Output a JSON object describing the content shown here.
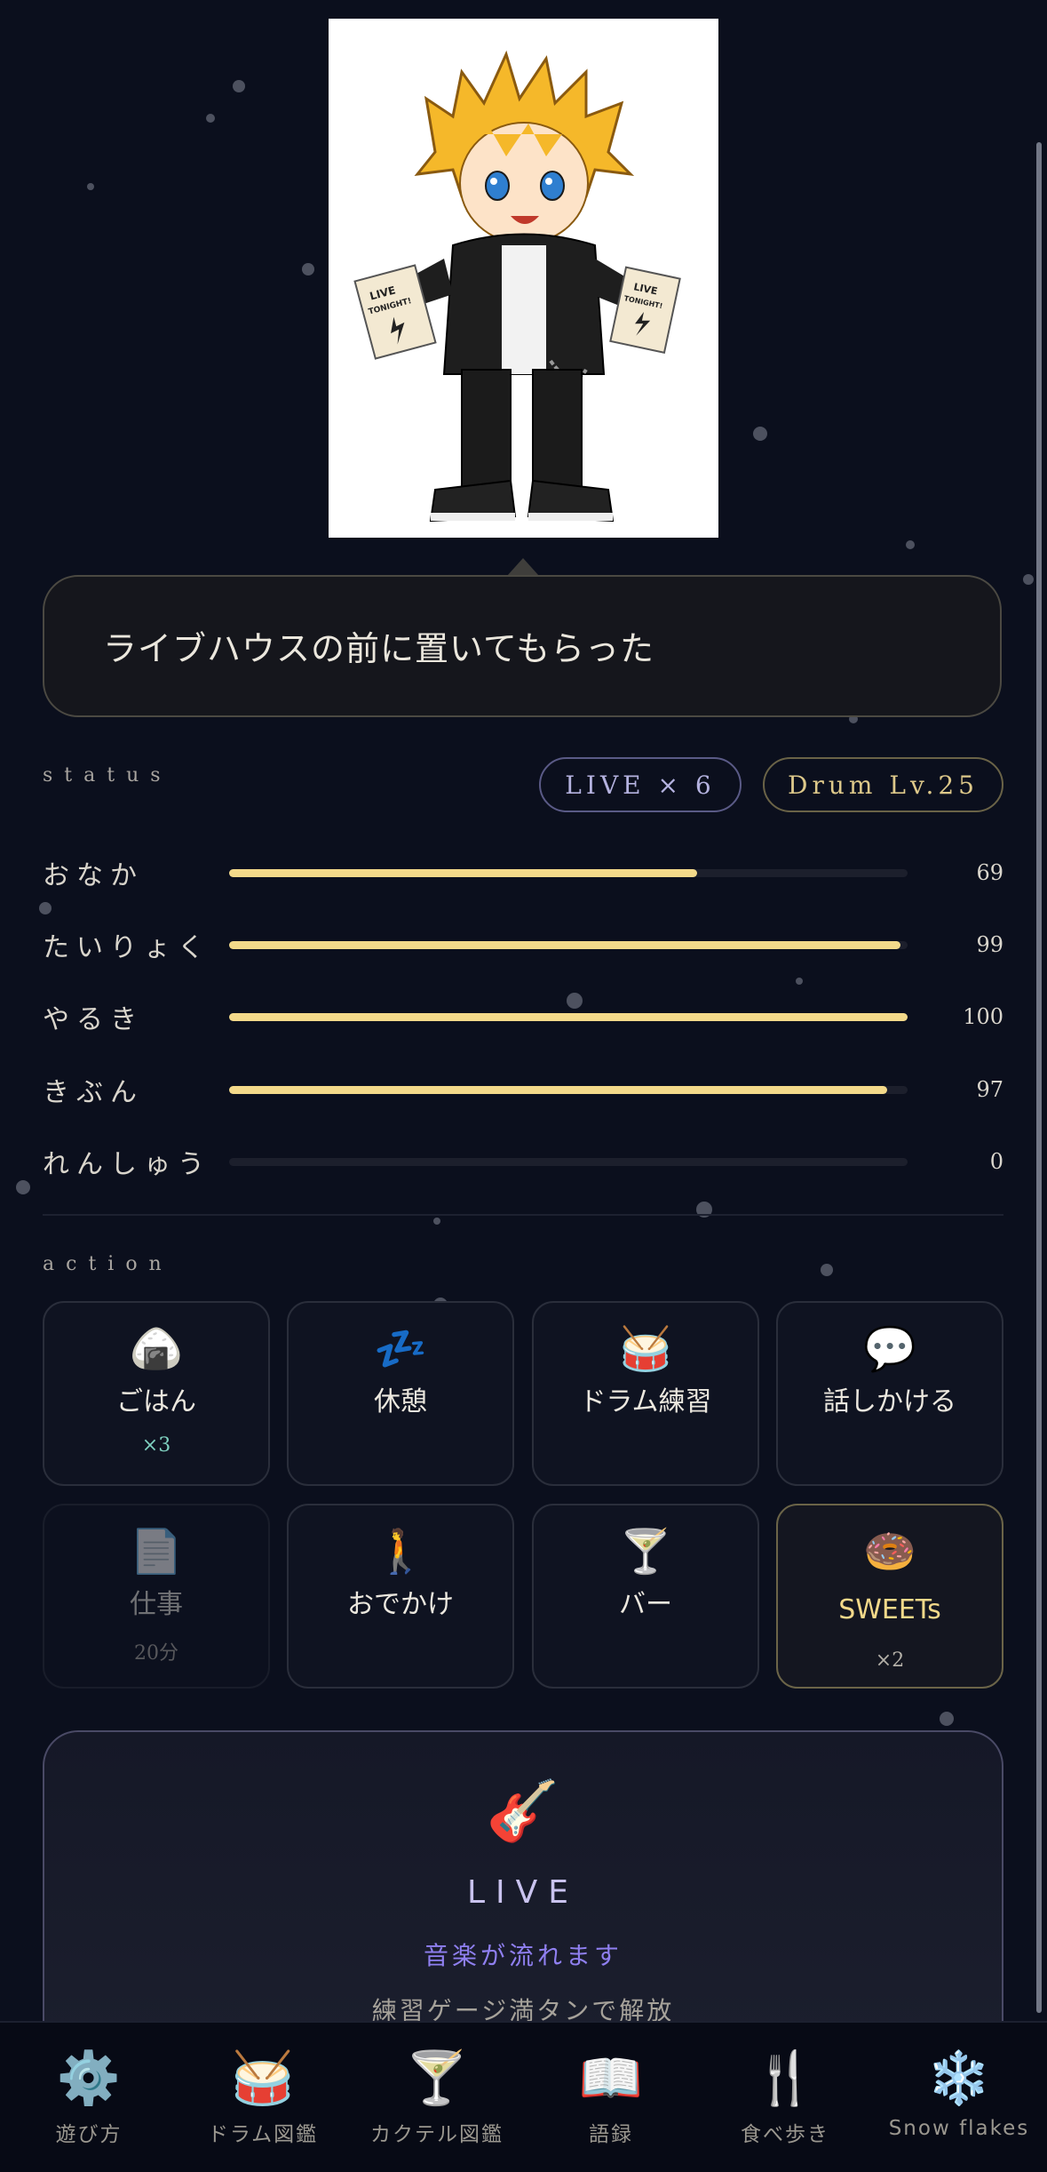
{
  "speech": {
    "text": "ライブハウスの前に置いてもらった"
  },
  "status": {
    "section_label": "status",
    "badges": {
      "live": "LIVE × 6",
      "drum": "Drum Lv.25"
    },
    "stats": [
      {
        "label": "おなか",
        "value": "69",
        "level": 0.69
      },
      {
        "label": "たいりょく",
        "value": "99",
        "level": 0.99
      },
      {
        "label": "やるき",
        "value": "100",
        "level": 1.0
      },
      {
        "label": "きぶん",
        "value": "97",
        "level": 0.97
      },
      {
        "label": "れんしゅう",
        "value": "0",
        "level": 0.0
      }
    ]
  },
  "action": {
    "section_label": "action",
    "items": [
      {
        "label": "ごはん",
        "sub": "×3",
        "icon": "rice-ball-icon",
        "glyph": "🍙"
      },
      {
        "label": "休憩",
        "sub": "",
        "icon": "sleep-icon",
        "glyph": "💤"
      },
      {
        "label": "ドラム練習",
        "sub": "",
        "icon": "drum-icon",
        "glyph": "🥁"
      },
      {
        "label": "話しかける",
        "sub": "",
        "icon": "speech-bubble-icon",
        "glyph": "💬"
      },
      {
        "label": "仕事",
        "sub": "20分",
        "icon": "document-icon",
        "glyph": "📄"
      },
      {
        "label": "おでかけ",
        "sub": "",
        "icon": "walking-person-icon",
        "glyph": "🚶"
      },
      {
        "label": "バー",
        "sub": "",
        "icon": "cocktail-icon",
        "glyph": "🍸"
      },
      {
        "label": "SWEETs",
        "sub": "×2",
        "icon": "donut-icon",
        "glyph": "🍩"
      }
    ]
  },
  "live_panel": {
    "icon": "guitar-icon",
    "glyph": "🎸",
    "title": "LIVE",
    "subtitle": "音楽が流れます",
    "note": "練習ゲージ満タンで解放"
  },
  "nav": [
    {
      "label": "遊び方",
      "icon": "gear-icon",
      "glyph": "⚙️"
    },
    {
      "label": "ドラム図鑑",
      "icon": "drum-icon",
      "glyph": "🥁"
    },
    {
      "label": "カクテル図鑑",
      "icon": "cocktail-icon",
      "glyph": "🍸"
    },
    {
      "label": "語録",
      "icon": "open-book-icon",
      "glyph": "📖"
    },
    {
      "label": "食べ歩き",
      "icon": "fork-knife-icon",
      "glyph": "🍴"
    },
    {
      "label": "Snow flakes",
      "icon": "snowflake-icon",
      "glyph": "❄️"
    }
  ],
  "colors": {
    "background": "#0b0f1d",
    "bar": "#f3d98a",
    "accent_live": "#8f7ff0",
    "sweets": "#f3d98a"
  }
}
